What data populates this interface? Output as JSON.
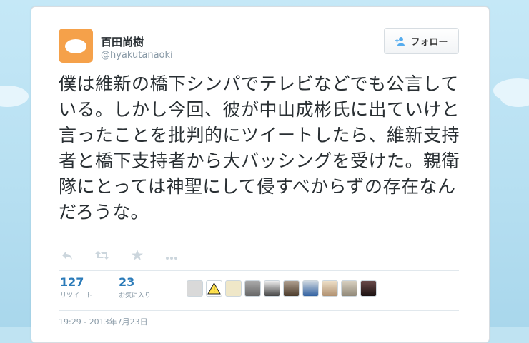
{
  "user": {
    "name": "百田尚樹",
    "handle": "@hyakutanaoki"
  },
  "follow_button": {
    "label": "フォロー"
  },
  "tweet": {
    "text": "僕は維新の橋下シンパでテレビなどでも公言している。しかし今回、彼が中山成彬氏に出ていけと言ったことを批判的にツイートしたら、維新支持者と橋下支持者から大バッシングを受けた。親衛隊にとっては神聖にして侵すべからずの存在なんだろうな。",
    "timestamp": "19:29 - 2013年7月23日"
  },
  "stats": {
    "retweets": {
      "count": "127",
      "label": "リツイート"
    },
    "favorites": {
      "count": "23",
      "label": "お気に入り"
    }
  },
  "actions": [
    "reply-icon",
    "retweet-icon",
    "favorite-icon",
    "more-icon"
  ],
  "avatars_colors": [
    "#d9d9d9",
    "#ffe14d",
    "#efe7c8",
    "#8a8a8a",
    "#6b6b6b",
    "#7d6a5a",
    "#9b8f86",
    "#d8cbb4",
    "#b9b2a2",
    "#3a2a2a"
  ]
}
